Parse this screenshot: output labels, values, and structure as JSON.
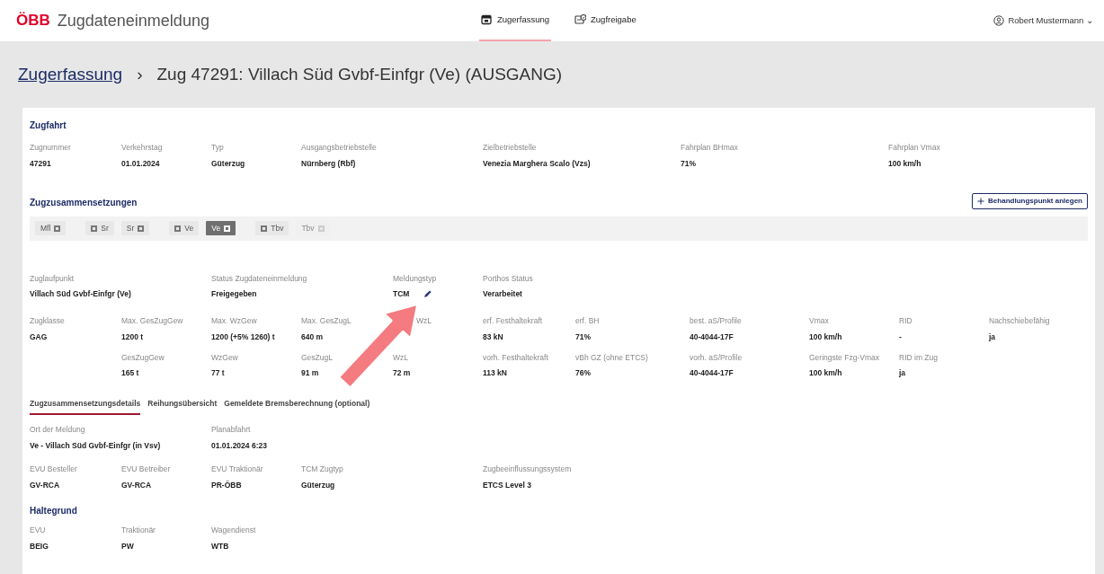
{
  "app": {
    "logo": "ÖBB",
    "title": "Zugdateneinmeldung"
  },
  "nav": [
    {
      "label": "Zugerfassung",
      "selected": true
    },
    {
      "label": "Zugfreigabe",
      "selected": false
    }
  ],
  "user": {
    "name": "Robert Mustermann",
    "caret": "⌄"
  },
  "breadcrumb": {
    "link": "Zugerfassung",
    "separator": "›",
    "title": "Zug 47291: Villach Süd Gvbf-Einfgr (Ve) (AUSGANG)"
  },
  "zugfahrt": {
    "heading": "Zugfahrt",
    "fields": [
      {
        "label": "Zugnummer",
        "value": "47291"
      },
      {
        "label": "Verkehrstag",
        "value": "01.01.2024"
      },
      {
        "label": "Typ",
        "value": "Güterzug"
      },
      {
        "label": "Ausgangsbetriebstelle",
        "value": "Nürnberg (Rbf)"
      },
      {
        "label": "Zielbetriebstelle",
        "value": "Venezia Marghera Scalo (Vzs)"
      },
      {
        "label": "Fahrplan BHmax",
        "value": "71%"
      },
      {
        "label": "Fahrplan Vmax",
        "value": "100 km/h"
      }
    ]
  },
  "zusammensetzungen": {
    "heading": "Zugzusammensetzungen",
    "button": "Behandlungspunkt anlegen",
    "chip_groups": [
      [
        {
          "label": "Mfl",
          "kind": "trailing",
          "selected": false,
          "disabled": false
        }
      ],
      [
        {
          "label": "Sr",
          "kind": "leading",
          "selected": false,
          "disabled": false
        },
        {
          "label": "Sr",
          "kind": "trailing",
          "selected": false,
          "disabled": false
        }
      ],
      [
        {
          "label": "Ve",
          "kind": "leading",
          "selected": false,
          "disabled": false
        },
        {
          "label": "Ve",
          "kind": "trailing",
          "selected": true,
          "disabled": false
        }
      ],
      [
        {
          "label": "Tbv",
          "kind": "leading",
          "selected": false,
          "disabled": false
        },
        {
          "label": "Tbv",
          "kind": "trailing",
          "selected": false,
          "disabled": true
        }
      ]
    ]
  },
  "summary": [
    {
      "label": "Zuglaufpunkt",
      "value": "Villach Süd Gvbf-Einfgr (Ve)",
      "kind": "wide",
      "editable": false
    },
    {
      "label": "Status Zugdateneinmeldung",
      "value": "Freigegeben",
      "kind": "wide",
      "editable": false
    },
    {
      "label": "Meldungstyp",
      "value": "TCM",
      "kind": "field",
      "editable": true
    },
    {
      "label": "Porthos Status",
      "value": "Verarbeitet",
      "kind": "field",
      "editable": false
    }
  ],
  "limits": {
    "zugklasse": {
      "label": "Zugklasse",
      "value": "GAG"
    },
    "rows": [
      [
        {
          "label": "Max. GesZugGew",
          "value": "1200 t"
        },
        {
          "label": "Max. WzGew",
          "value": "1200 (+5% 1260) t"
        },
        {
          "label": "Max. GesZugL",
          "value": "640 m"
        },
        {
          "label": "WzL",
          "kind": "covered"
        },
        {
          "label": "erf. Festhaltekraft",
          "value": "83 kN"
        },
        {
          "label": "erf. BH",
          "value": "71%"
        },
        {
          "label": "best. aS/Profile",
          "value": "40-4044-17F"
        },
        {
          "label": "Vmax",
          "value": "100 km/h"
        },
        {
          "label": "RID",
          "value": "-"
        },
        {
          "label": "Nachschiebefähig",
          "value": "ja"
        }
      ],
      [
        {
          "label": "GesZugGew",
          "value": "165 t"
        },
        {
          "label": "WzGew",
          "value": "77 t"
        },
        {
          "label": "GesZugL",
          "value": "91 m"
        },
        {
          "label": "WzL",
          "value": "72 m"
        },
        {
          "label": "vorh. Festhaltekraft",
          "value": "113 kN"
        },
        {
          "label": "vBh GZ (ohne ETCS)",
          "value": "76%"
        },
        {
          "label": "vorh. aS/Profile",
          "value": "40-4044-17F"
        },
        {
          "label": "Geringste Fzg-Vmax",
          "value": "100 km/h"
        },
        {
          "label": "RID im Zug",
          "value": "ja"
        }
      ]
    ]
  },
  "tabs": [
    {
      "label": "Zugzusammensetzungsdetails",
      "selected": true
    },
    {
      "label": "Reihungsübersicht",
      "selected": false
    },
    {
      "label": "Gemeldete Bremsberechnung (optional)",
      "selected": false
    }
  ],
  "details": [
    [
      {
        "label": "Ort der Meldung",
        "value": "Ve - Villach Süd Gvbf-Einfgr (in Vsv)",
        "kind": "wide"
      },
      {
        "label": "Planabfahrt",
        "value": "01.01.2024 6:23",
        "kind": "wide"
      }
    ],
    [
      {
        "label": "EVU Besteller",
        "value": "GV-RCA",
        "kind": "field"
      },
      {
        "label": "EVU Betreiber",
        "value": "GV-RCA",
        "kind": "field"
      },
      {
        "label": "EVU Traktionär",
        "value": "PR-ÖBB",
        "kind": "field"
      },
      {
        "label": "TCM Zugtyp",
        "value": "Güterzug",
        "kind": "wide"
      },
      {
        "label": "Zugbeeinflussungssystem",
        "value": "ETCS Level 3",
        "kind": "field"
      }
    ]
  ],
  "haltegrund": {
    "heading": "Haltegrund",
    "fields": [
      {
        "label": "EVU",
        "value": "BEIG"
      },
      {
        "label": "Traktionär",
        "value": "PW"
      },
      {
        "label": "Wagendienst",
        "value": "WTB"
      }
    ]
  }
}
